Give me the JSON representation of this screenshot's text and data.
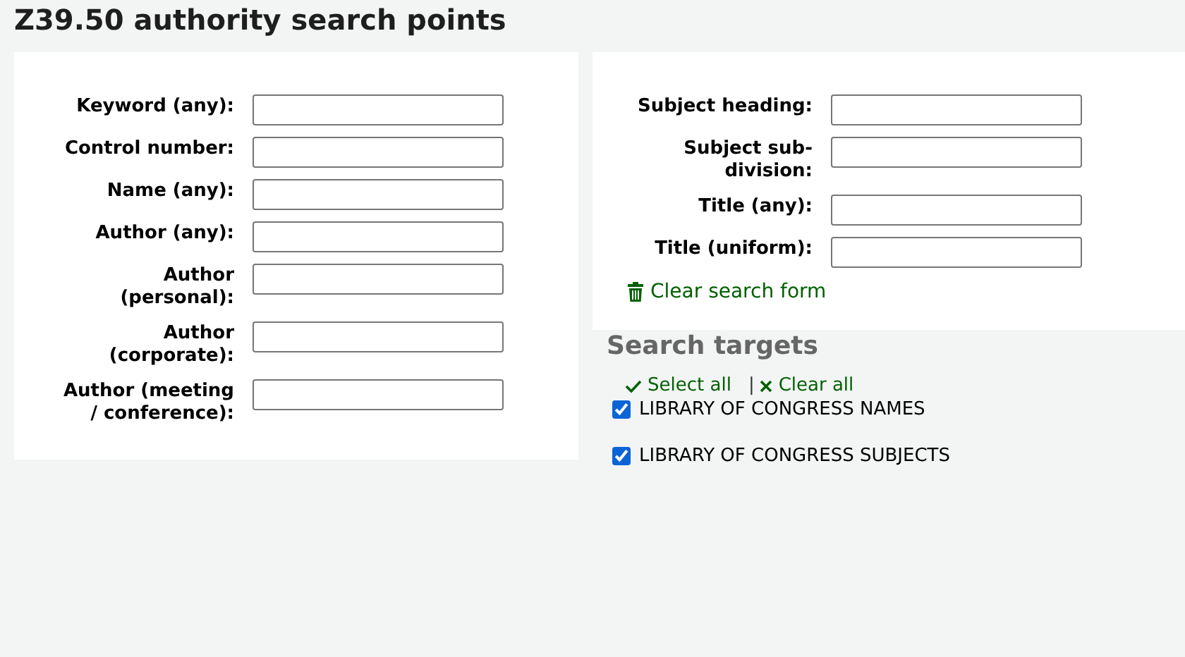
{
  "title": "Z39.50 authority search points",
  "left_fields": [
    {
      "label": "Keyword (any):"
    },
    {
      "label": "Control number:"
    },
    {
      "label": "Name (any):"
    },
    {
      "label": "Author (any):"
    },
    {
      "label": "Author (personal):"
    },
    {
      "label": "Author (corporate):"
    },
    {
      "label": "Author (meeting / conference):"
    }
  ],
  "right_fields": [
    {
      "label": "Subject heading:"
    },
    {
      "label": "Subject sub-division:"
    },
    {
      "label": "Title (any):"
    },
    {
      "label": "Title (uniform):"
    }
  ],
  "clear_form": "Clear search form",
  "targets_heading": "Search targets",
  "select_all": "Select all",
  "separator": "|",
  "clear_all": "Clear all",
  "targets": [
    {
      "label": "LIBRARY OF CONGRESS NAMES",
      "checked": true
    },
    {
      "label": "LIBRARY OF CONGRESS SUBJECTS",
      "checked": true
    }
  ]
}
